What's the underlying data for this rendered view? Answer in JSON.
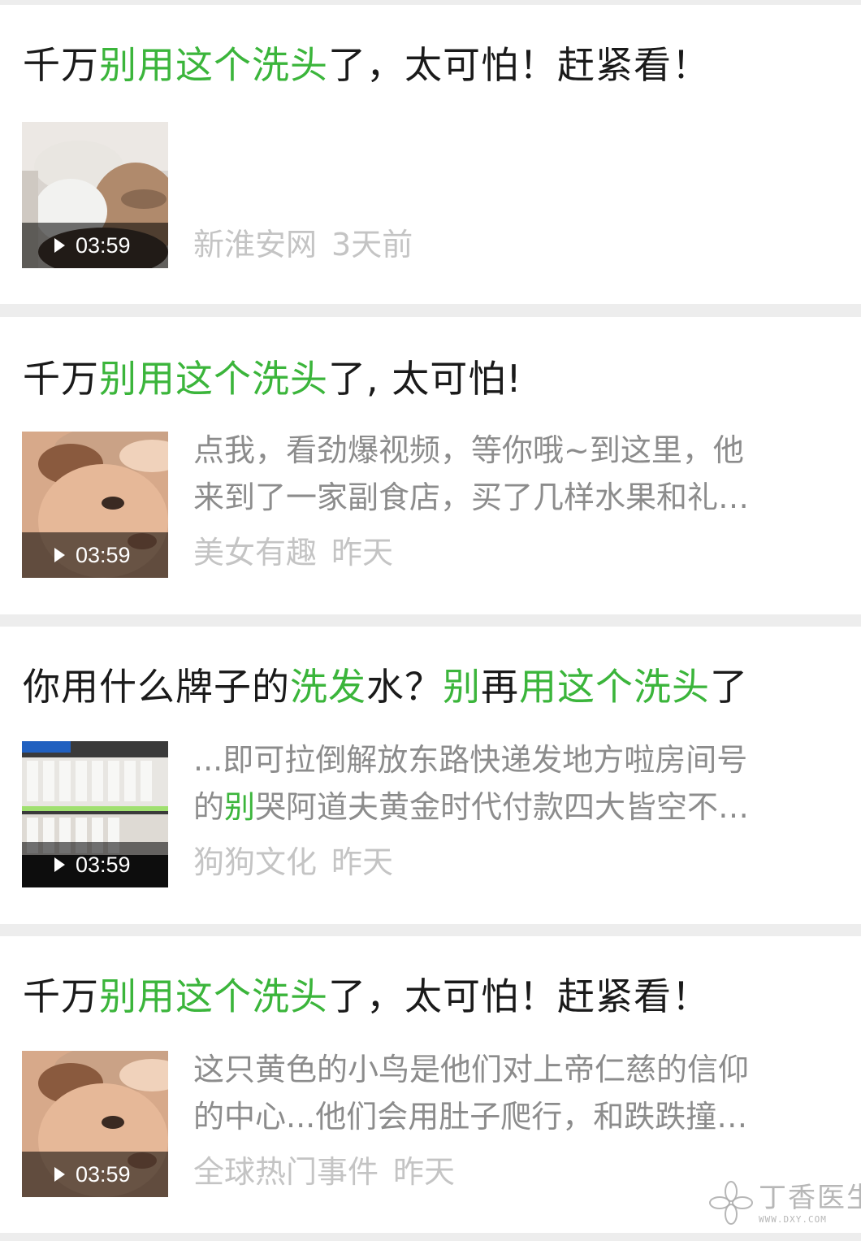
{
  "colors": {
    "highlight": "#3bb53b",
    "title": "#1a1a1a",
    "snippet": "#8c8c8c",
    "meta": "#c4c4c4"
  },
  "results": [
    {
      "title_parts": [
        {
          "text": "千万",
          "hl": false
        },
        {
          "text": "别用这个洗头",
          "hl": true
        },
        {
          "text": "了，太可怕！赶紧看！",
          "hl": false
        }
      ],
      "duration": "03:59",
      "snippet_lines": [],
      "source": "新淮安网",
      "time": "3天前"
    },
    {
      "title_parts": [
        {
          "text": "千万",
          "hl": false
        },
        {
          "text": "别用这个洗头",
          "hl": true
        },
        {
          "text": "了, 太可怕!",
          "hl": false
        }
      ],
      "duration": "03:59",
      "snippet_lines": [
        [
          {
            "text": "点我，看劲爆视频，等你哦~到这里，他",
            "hl": false
          }
        ],
        [
          {
            "text": "来到了一家副食店，买了几样水果和礼…",
            "hl": false
          }
        ]
      ],
      "source": "美女有趣",
      "time": "昨天"
    },
    {
      "title_parts": [
        {
          "text": "你用什么牌子的",
          "hl": false
        },
        {
          "text": "洗发",
          "hl": true
        },
        {
          "text": "水？",
          "hl": false
        },
        {
          "text": "别",
          "hl": true
        },
        {
          "text": "再",
          "hl": false
        },
        {
          "text": "用这个洗头",
          "hl": true
        },
        {
          "text": "了",
          "hl": false
        }
      ],
      "duration": "03:59",
      "snippet_lines": [
        [
          {
            "text": "...即可拉倒解放东路快递发地方啦房间号",
            "hl": false
          }
        ],
        [
          {
            "text": "的",
            "hl": false
          },
          {
            "text": "别",
            "hl": true
          },
          {
            "text": "哭阿道夫黄金时代付款四大皆空不…",
            "hl": false
          }
        ]
      ],
      "source": "狗狗文化",
      "time": "昨天"
    },
    {
      "title_parts": [
        {
          "text": "千万",
          "hl": false
        },
        {
          "text": "别用这个洗头",
          "hl": true
        },
        {
          "text": "了，太可怕！赶紧看！",
          "hl": false
        }
      ],
      "duration": "03:59",
      "snippet_lines": [
        [
          {
            "text": "这只黄色的小鸟是他们对上帝仁慈的信仰",
            "hl": false
          }
        ],
        [
          {
            "text": "的中心...他们会用肚子爬行，和跌跌撞…",
            "hl": false
          }
        ]
      ],
      "source": "全球热门事件",
      "time": "昨天"
    }
  ],
  "watermark": {
    "brand": "丁香医生",
    "url": "WWW.DXY.COM"
  }
}
